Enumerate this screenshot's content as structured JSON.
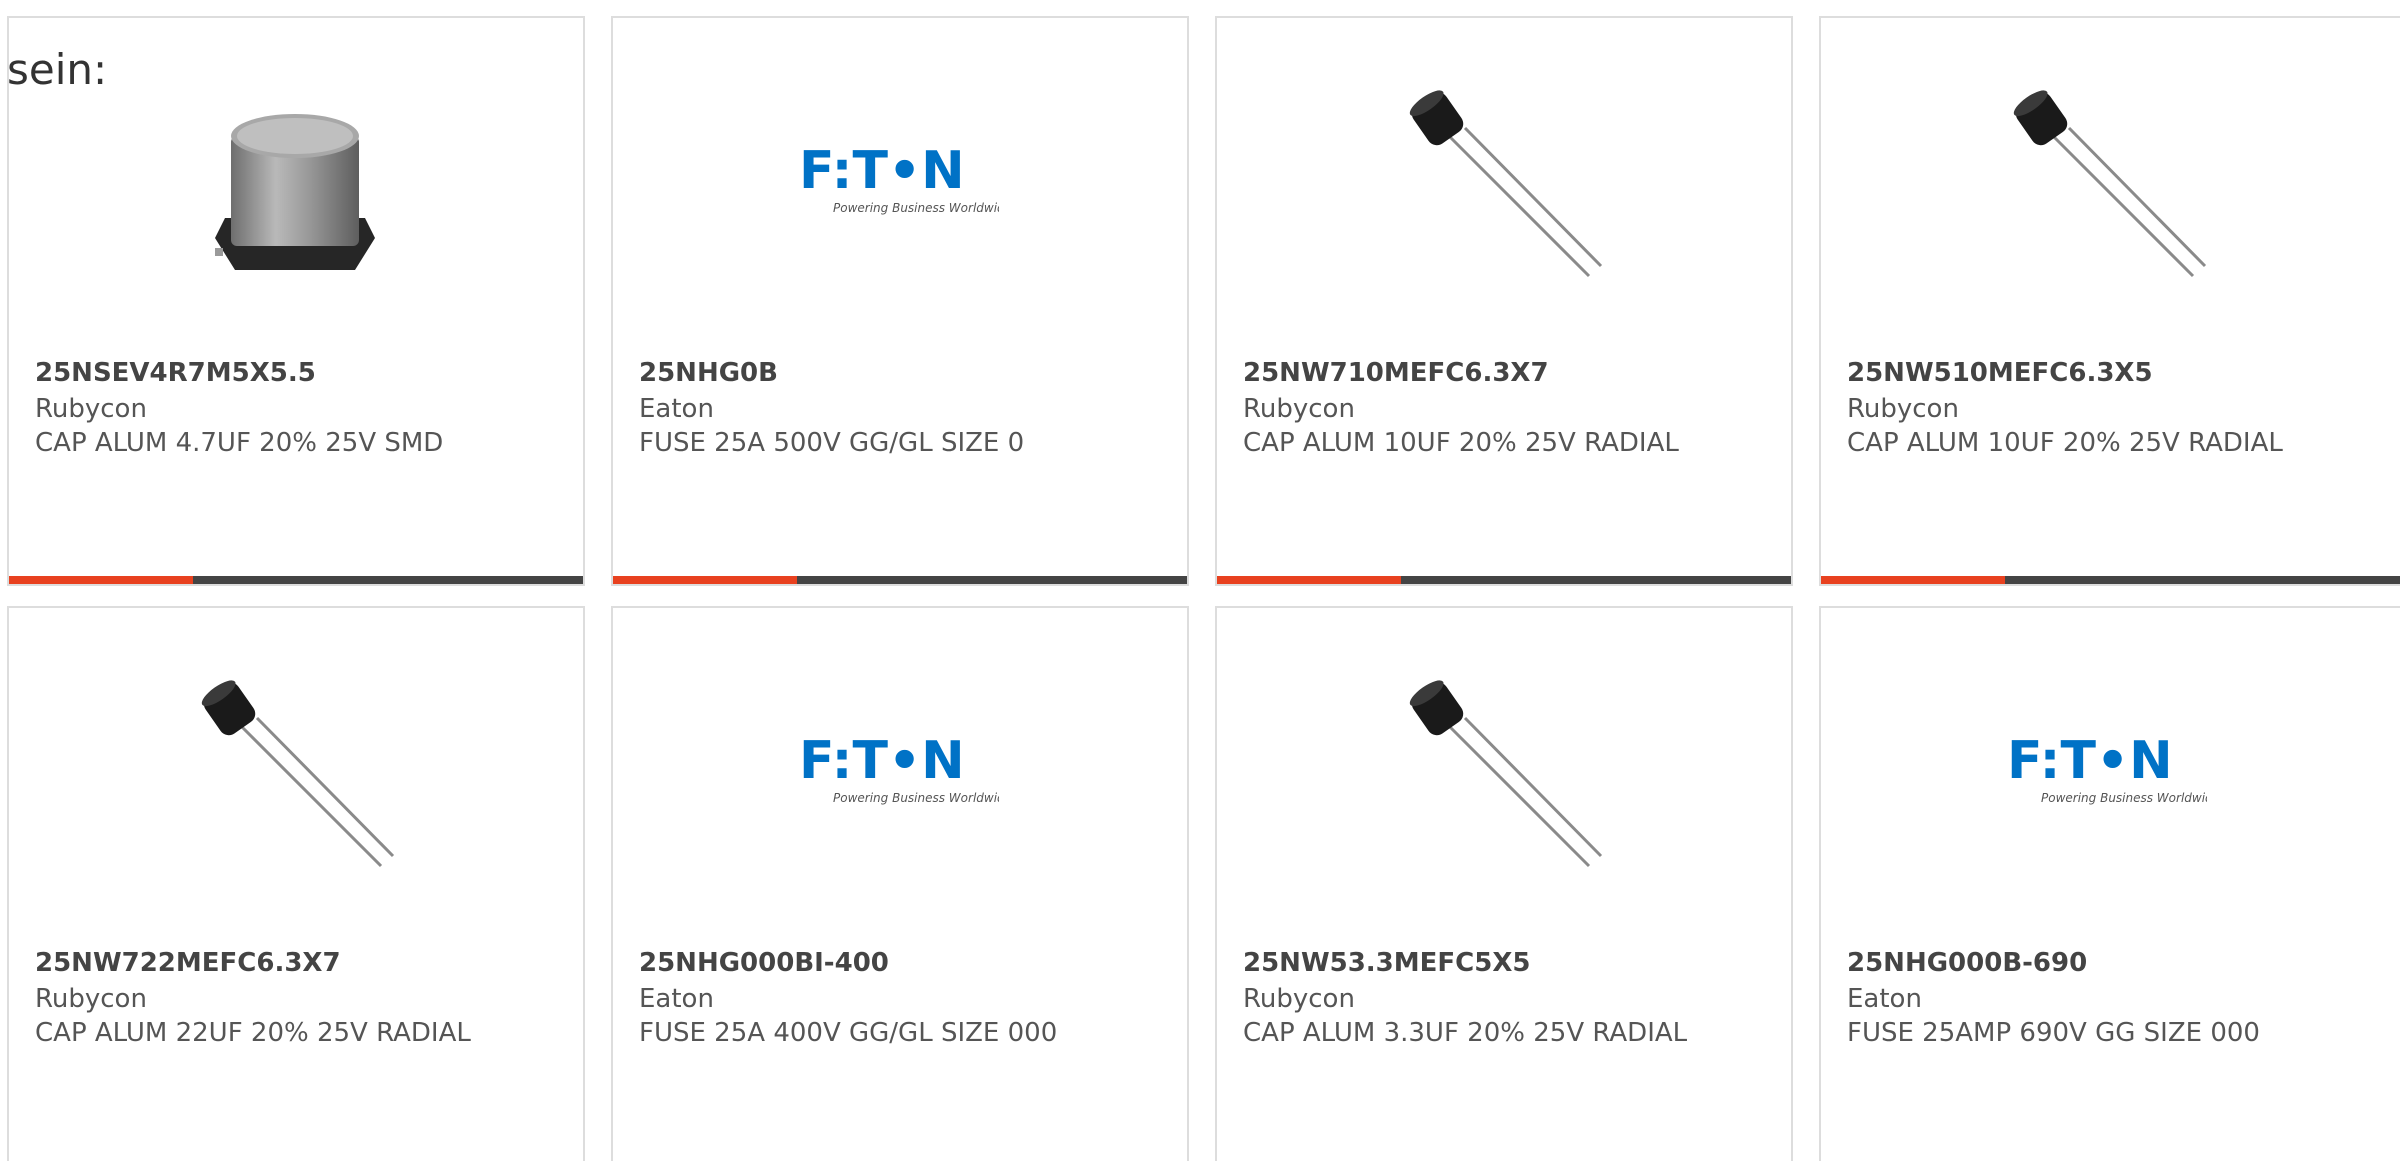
{
  "intro_text": "sein:",
  "colors": {
    "accent": "#e8411f",
    "bar": "#444444",
    "eaton_blue": "#0072c6"
  },
  "products": [
    {
      "part_number": "25NSEV4R7M5X5.5",
      "manufacturer": "Rubycon",
      "description": "CAP ALUM 4.7UF 20% 25V SMD",
      "image": "smd-capacitor-image"
    },
    {
      "part_number": "25NHG0B",
      "manufacturer": "Eaton",
      "description": "FUSE 25A 500V GG/GL SIZE 0",
      "image": "eaton-logo",
      "logo_text": "F:T•N",
      "logo_tagline": "Powering Business Worldwide"
    },
    {
      "part_number": "25NW710MEFC6.3X7",
      "manufacturer": "Rubycon",
      "description": "CAP ALUM 10UF 20% 25V RADIAL",
      "image": "radial-capacitor-image"
    },
    {
      "part_number": "25NW510MEFC6.3X5",
      "manufacturer": "Rubycon",
      "description": "CAP ALUM 10UF 20% 25V RADIAL",
      "image": "radial-capacitor-image"
    },
    {
      "part_number": "25NW722MEFC6.3X7",
      "manufacturer": "Rubycon",
      "description": "CAP ALUM 22UF 20% 25V RADIAL",
      "image": "radial-capacitor-image"
    },
    {
      "part_number": "25NHG000BI-400",
      "manufacturer": "Eaton",
      "description": "FUSE 25A 400V GG/GL SIZE 000",
      "image": "eaton-logo",
      "logo_text": "F:T•N",
      "logo_tagline": "Powering Business Worldwide"
    },
    {
      "part_number": "25NW53.3MEFC5X5",
      "manufacturer": "Rubycon",
      "description": "CAP ALUM 3.3UF 20% 25V RADIAL",
      "image": "radial-capacitor-image"
    },
    {
      "part_number": "25NHG000B-690",
      "manufacturer": "Eaton",
      "description": "FUSE 25AMP 690V GG SIZE 000",
      "image": "eaton-logo",
      "logo_text": "F:T•N",
      "logo_tagline": "Powering Business Worldwide"
    }
  ]
}
